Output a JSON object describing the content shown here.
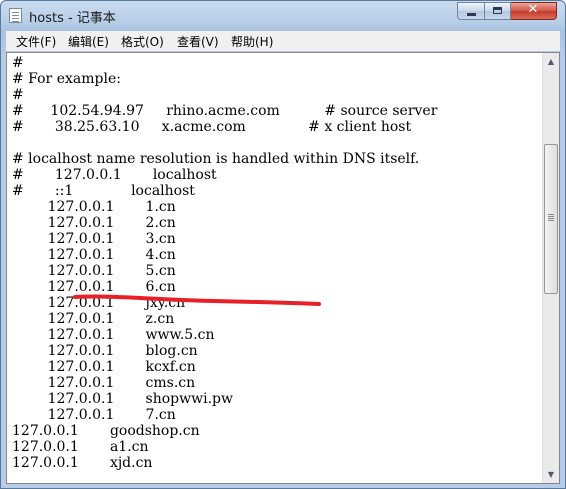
{
  "window": {
    "title": "hosts - 记事本",
    "controls": {
      "minimize_icon": "minimize-icon",
      "maximize_icon": "maximize-icon",
      "close_glyph": "✕"
    }
  },
  "menu": {
    "items": [
      "文件(F)",
      "编辑(E)",
      "格式(O)",
      "查看(V)",
      "帮助(H)"
    ]
  },
  "editor": {
    "lines": [
      "#",
      "# For example:",
      "#",
      "#      102.54.94.97     rhino.acme.com          # source server",
      "#       38.25.63.10     x.acme.com              # x client host",
      "",
      "# localhost name resolution is handled within DNS itself.",
      "#       127.0.0.1       localhost",
      "#       ::1             localhost",
      "        127.0.0.1       1.cn",
      "        127.0.0.1       2.cn",
      "        127.0.0.1       3.cn",
      "        127.0.0.1       4.cn",
      "        127.0.0.1       5.cn",
      "        127.0.0.1       6.cn",
      "        127.0.0.1       jxy.cn",
      "        127.0.0.1       z.cn",
      "        127.0.0.1       www.5.cn",
      "        127.0.0.1       blog.cn",
      "        127.0.0.1       kcxf.cn",
      "        127.0.0.1       cms.cn",
      "        127.0.0.1       shopwwi.pw",
      "        127.0.0.1       7.cn",
      "127.0.0.1       goodshop.cn",
      "127.0.0.1       a1.cn",
      "127.0.0.1       xjd.cn"
    ],
    "annotation_color": "#e8202a"
  },
  "scrollbar": {
    "position_fraction": 0.3
  }
}
